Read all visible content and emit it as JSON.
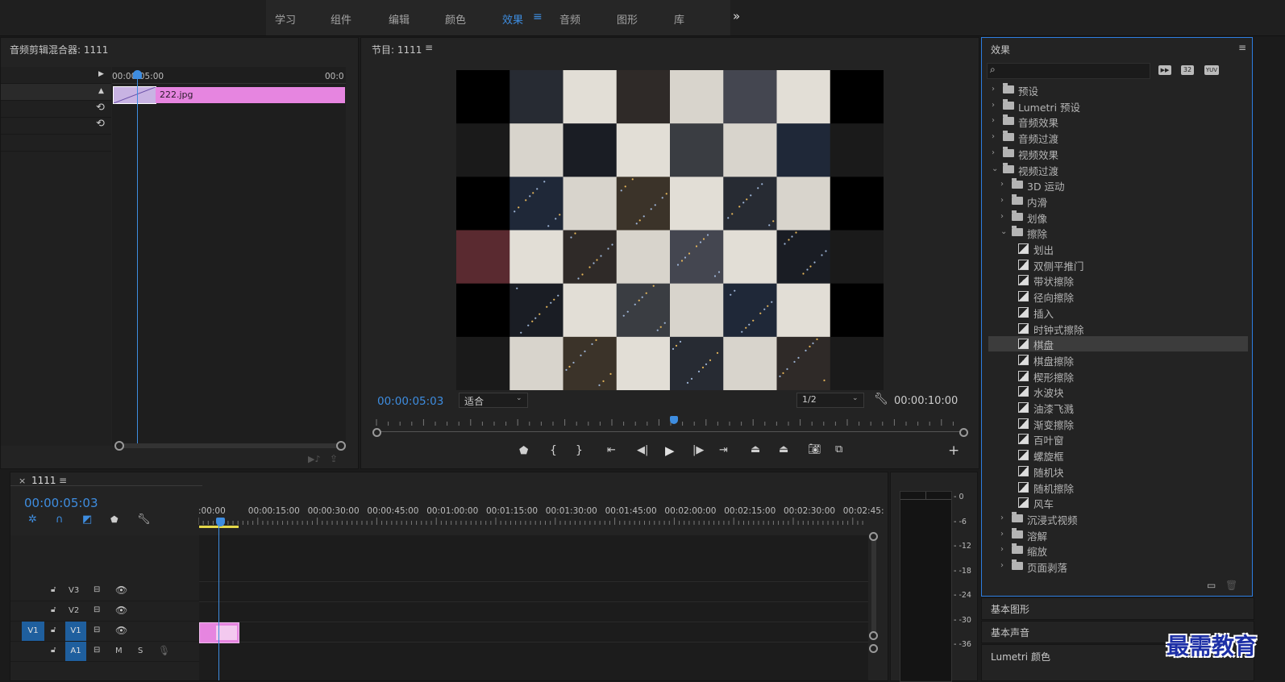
{
  "workspaces": [
    {
      "label": "学习"
    },
    {
      "label": "组件"
    },
    {
      "label": "编辑"
    },
    {
      "label": "颜色"
    },
    {
      "label": "效果"
    },
    {
      "label": "音频"
    },
    {
      "label": "图形"
    },
    {
      "label": "库"
    }
  ],
  "workspace_more": "»",
  "mixer": {
    "title": "音频剪辑混合器: 1111",
    "ruler_start": "00:00:05:00",
    "ruler_end": "00:0",
    "clip_name": "222.jpg"
  },
  "program": {
    "title": "节目: 1111",
    "timecode_current": "00:00:05:03",
    "fit_label": "适合",
    "resolution": "1/2",
    "timecode_duration": "00:00:10:00"
  },
  "effects": {
    "title": "效果",
    "search_placeholder": "",
    "filter_icons": [
      "加速效果",
      "32",
      "YUV"
    ],
    "tree": [
      {
        "label": "预设",
        "level": 0,
        "type": "folder-star",
        "expanded": false
      },
      {
        "label": "Lumetri 预设",
        "level": 0,
        "type": "folder-star",
        "expanded": false
      },
      {
        "label": "音频效果",
        "level": 0,
        "type": "folder",
        "expanded": false
      },
      {
        "label": "音频过渡",
        "level": 0,
        "type": "folder",
        "expanded": false
      },
      {
        "label": "视频效果",
        "level": 0,
        "type": "folder",
        "expanded": false
      },
      {
        "label": "视频过渡",
        "level": 0,
        "type": "folder",
        "expanded": true
      },
      {
        "label": "3D 运动",
        "level": 1,
        "type": "folder",
        "expanded": false
      },
      {
        "label": "内滑",
        "level": 1,
        "type": "folder",
        "expanded": false
      },
      {
        "label": "划像",
        "level": 1,
        "type": "folder",
        "expanded": false
      },
      {
        "label": "擦除",
        "level": 1,
        "type": "folder",
        "expanded": true
      },
      {
        "label": "划出",
        "level": 2,
        "type": "fx"
      },
      {
        "label": "双侧平推门",
        "level": 2,
        "type": "fx"
      },
      {
        "label": "带状擦除",
        "level": 2,
        "type": "fx"
      },
      {
        "label": "径向擦除",
        "level": 2,
        "type": "fx"
      },
      {
        "label": "插入",
        "level": 2,
        "type": "fx"
      },
      {
        "label": "时钟式擦除",
        "level": 2,
        "type": "fx"
      },
      {
        "label": "棋盘",
        "level": 2,
        "type": "fx",
        "selected": true
      },
      {
        "label": "棋盘擦除",
        "level": 2,
        "type": "fx"
      },
      {
        "label": "楔形擦除",
        "level": 2,
        "type": "fx"
      },
      {
        "label": "水波块",
        "level": 2,
        "type": "fx"
      },
      {
        "label": "油漆飞溅",
        "level": 2,
        "type": "fx"
      },
      {
        "label": "渐变擦除",
        "level": 2,
        "type": "fx"
      },
      {
        "label": "百叶窗",
        "level": 2,
        "type": "fx"
      },
      {
        "label": "螺旋框",
        "level": 2,
        "type": "fx"
      },
      {
        "label": "随机块",
        "level": 2,
        "type": "fx"
      },
      {
        "label": "随机擦除",
        "level": 2,
        "type": "fx"
      },
      {
        "label": "风车",
        "level": 2,
        "type": "fx"
      },
      {
        "label": "沉浸式视频",
        "level": 1,
        "type": "folder",
        "expanded": false
      },
      {
        "label": "溶解",
        "level": 1,
        "type": "folder",
        "expanded": false
      },
      {
        "label": "缩放",
        "level": 1,
        "type": "folder",
        "expanded": false
      },
      {
        "label": "页面剥落",
        "level": 1,
        "type": "folder",
        "expanded": false
      }
    ]
  },
  "side_panels": [
    {
      "label": "基本图形"
    },
    {
      "label": "基本声音"
    },
    {
      "label": "Lumetri 颜色"
    }
  ],
  "timeline": {
    "tab_close": "×",
    "tab_label": "1111",
    "timecode": "00:00:05:03",
    "ruler_labels": [
      ":00:00",
      "00:00:15:00",
      "00:00:30:00",
      "00:00:45:00",
      "00:01:00:00",
      "00:01:15:00",
      "00:01:30:00",
      "00:01:45:00",
      "00:02:00:00",
      "00:02:15:00",
      "00:02:30:00",
      "00:02:45:"
    ],
    "tracks": [
      {
        "name": "V3",
        "src": ""
      },
      {
        "name": "V2",
        "src": ""
      },
      {
        "name": "V1",
        "src": "V1"
      },
      {
        "name": "A1",
        "src": "A1",
        "m": "M",
        "s": "S"
      }
    ]
  },
  "meter_labels": [
    "0",
    "-6",
    "-12",
    "-18",
    "-24",
    "-30",
    "-36"
  ],
  "watermark": "最需教育",
  "colors": {
    "accent": "#3e8de0",
    "clip_pink": "#e685e0",
    "panel": "#232323",
    "selection": "#3c3c3c"
  }
}
